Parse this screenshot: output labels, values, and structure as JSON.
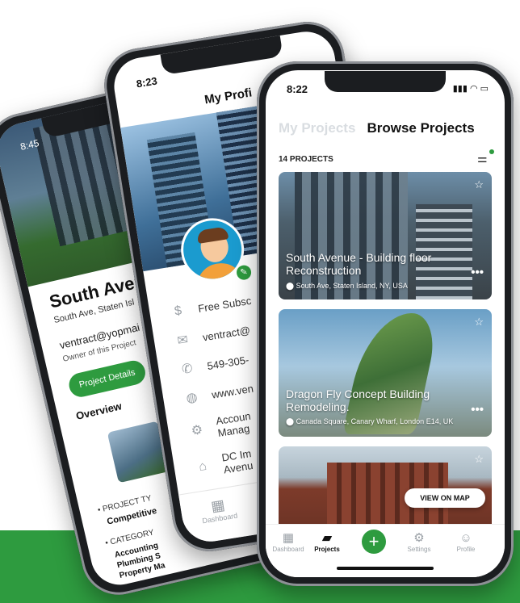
{
  "back_phone": {
    "time": "8:45",
    "title": "South Avenu",
    "address": "South Ave, Staten Isl",
    "email": "ventract@yopmai",
    "owner": "Owner of this Project",
    "project_details_btn": "Project Details",
    "overview": "Overview",
    "project_type_label": "• PROJECT TY",
    "project_type_value": "Competitive",
    "category_label": "• CATEGORY",
    "category_value": "Accounting\nPlumbing S\nProperty Ma"
  },
  "mid_phone": {
    "time": "8:23",
    "header": "My Profi",
    "info": [
      {
        "icon": "dollar-icon",
        "glyph": "$",
        "text": "Free Subsc"
      },
      {
        "icon": "mail-icon",
        "glyph": "✉",
        "text": "ventract@"
      },
      {
        "icon": "phone-icon",
        "glyph": "✆",
        "text": "549-305-"
      },
      {
        "icon": "globe-icon",
        "glyph": "◍",
        "text": "www.ven"
      },
      {
        "icon": "gear-icon",
        "glyph": "⚙",
        "text": "Accoun\nManag"
      },
      {
        "icon": "home-icon",
        "glyph": "⌂",
        "text": "DC Im\nAvenu"
      }
    ],
    "edit_btn": "E",
    "tab_dashboard": "Dashboard"
  },
  "front_phone": {
    "time": "8:22",
    "tab_my_projects": "My Projects",
    "tab_browse_projects": "Browse Projects",
    "count": "14 PROJECTS",
    "cards": [
      {
        "title": "South Avenue - Building floor Reconstruction",
        "location": "South Ave, Staten Island, NY, USA"
      },
      {
        "title": "Dragon Fly Concept Building Remodeling.",
        "location": "Canada Square, Canary Wharf, London E14, UK"
      }
    ],
    "view_on_map": "VIEW ON MAP",
    "tabbar": {
      "dashboard": "Dashboard",
      "projects": "Projects",
      "settings": "Settings",
      "profile": "Profile"
    }
  },
  "colors": {
    "brand_green": "#2e9b3f"
  }
}
